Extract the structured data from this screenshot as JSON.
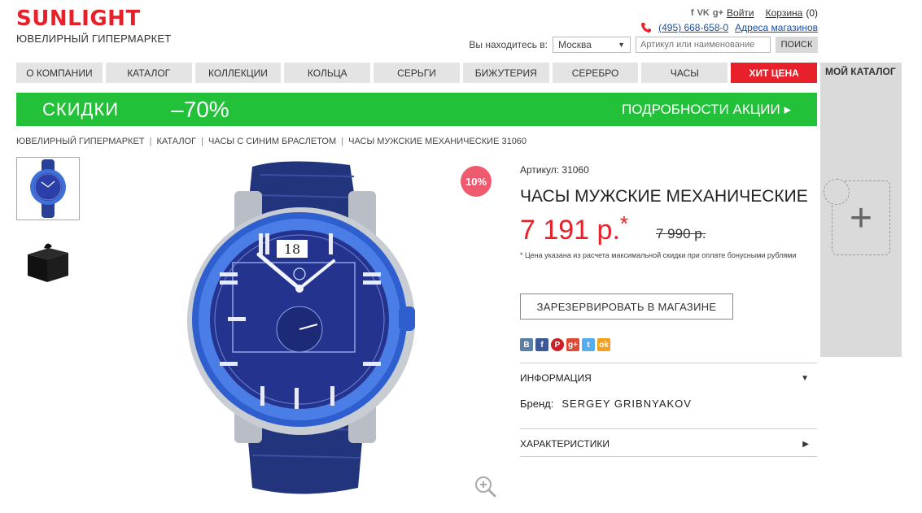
{
  "header": {
    "logo": "SUNLIGHT",
    "logo_subtitle": "ЮВЕЛИРНЫЙ ГИПЕРМАРКЕТ",
    "social_mini": "f",
    "social_vk": "VK",
    "social_gplus": "g+",
    "login_label": "Войти",
    "cart_label": "Корзина",
    "cart_count": "(0)",
    "phone": "(495) 668-658-0",
    "stores_link": "Адреса магазинов",
    "location_label": "Вы находитесь в:",
    "city": "Москва",
    "search_placeholder": "Артикул или наименование",
    "search_button": "ПОИСК"
  },
  "nav": {
    "items": [
      "О КОМПАНИИ",
      "КАТАЛОГ",
      "КОЛЛЕКЦИИ",
      "КОЛЬЦА",
      "СЕРЬГИ",
      "БИЖУТЕРИЯ",
      "СЕРЕБРО",
      "ЧАСЫ",
      "ХИТ ЦЕНА"
    ]
  },
  "my_catalog": {
    "title": "МОЙ КАТАЛОГ",
    "add_symbol": "+"
  },
  "promo": {
    "text1": "СКИДКИ",
    "text2": "–70%",
    "link": "ПОДРОБНОСТИ АКЦИИ ▸"
  },
  "breadcrumb": {
    "items": [
      "ЮВЕЛИРНЫЙ ГИПЕРМАРКЕТ",
      "КАТАЛОГ",
      "ЧАСЫ С СИНИМ БРАСЛЕТОМ",
      "ЧАСЫ МУЖСКИЕ МЕХАНИЧЕСКИЕ 31060"
    ],
    "separator": "|"
  },
  "product": {
    "discount_badge": "10%",
    "article": "Артикул: 31060",
    "title": "ЧАСЫ МУЖСКИЕ МЕХАНИЧЕСКИЕ",
    "price": "7 191 р.",
    "price_mark": "*",
    "old_price": "7 990 р.",
    "price_note": "* Цена указана из расчета максимальной скидки при оплате бонусными рублями",
    "reserve_button": "ЗАРЕЗЕРВИРОВАТЬ В МАГАЗИНЕ",
    "watch_date": "18"
  },
  "share": {
    "buttons": [
      {
        "label": "В",
        "color": "#5b7fa6"
      },
      {
        "label": "f",
        "color": "#3b5998"
      },
      {
        "label": "P",
        "color": "#cb2027"
      },
      {
        "label": "g+",
        "color": "#dd4b39"
      },
      {
        "label": "t",
        "color": "#55acee"
      },
      {
        "label": "ok",
        "color": "#f2a01e"
      }
    ]
  },
  "info": {
    "info_title": "ИНФОРМАЦИЯ",
    "brand_label": "Бренд:",
    "brand_value": "SERGEY GRIBNYAKOV",
    "specs_title": "ХАРАКТЕРИСТИКИ"
  },
  "colors": {
    "brand_red": "#e8202a",
    "promo_green": "#22c139",
    "link_blue": "#1a4fa0"
  }
}
